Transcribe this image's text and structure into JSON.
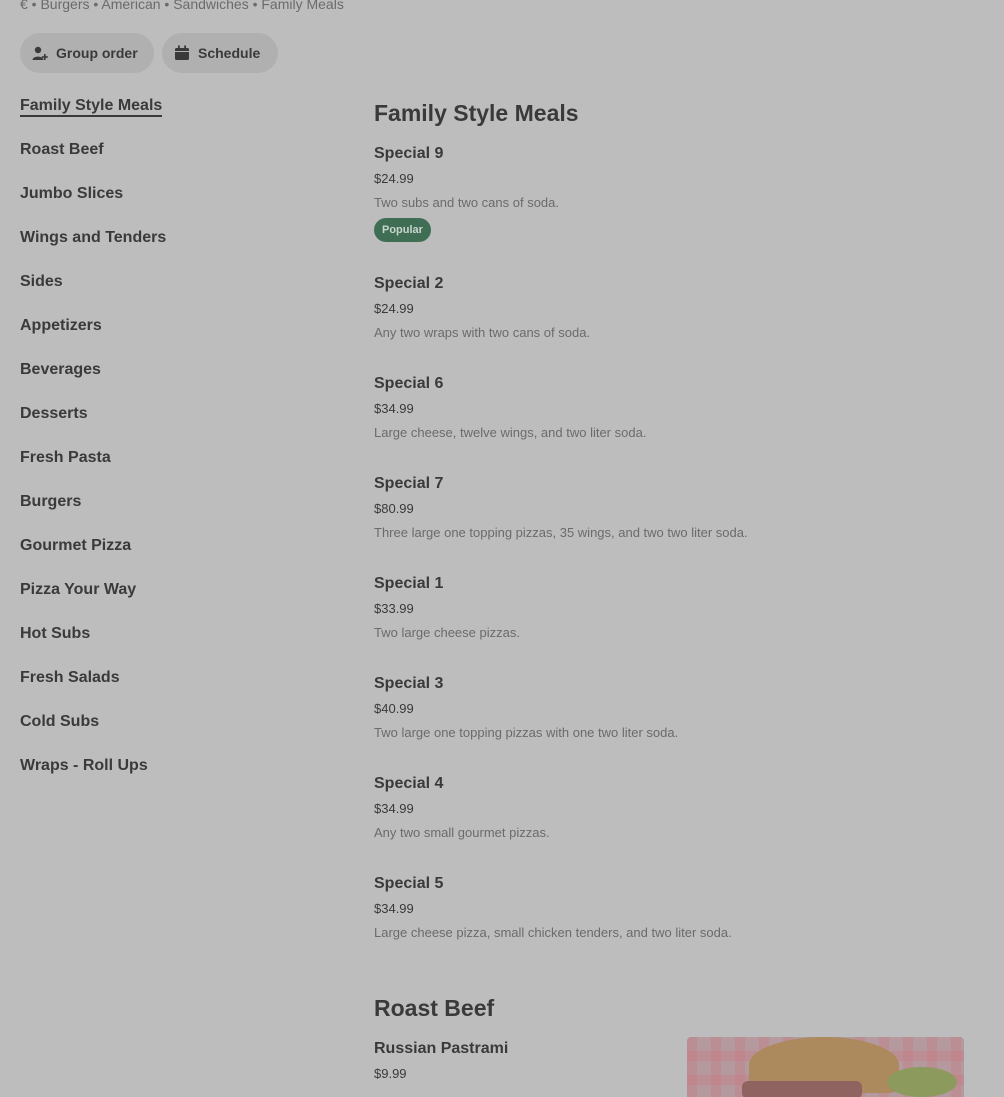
{
  "header": {
    "tagline": "€ • Burgers • American • Sandwiches • Family Meals",
    "group_order_label": "Group order",
    "schedule_label": "Schedule"
  },
  "sidebar": {
    "items": [
      {
        "label": "Family Style Meals",
        "active": true
      },
      {
        "label": "Roast Beef"
      },
      {
        "label": "Jumbo Slices"
      },
      {
        "label": "Wings and Tenders"
      },
      {
        "label": "Sides"
      },
      {
        "label": "Appetizers"
      },
      {
        "label": "Beverages"
      },
      {
        "label": "Desserts"
      },
      {
        "label": "Fresh Pasta"
      },
      {
        "label": "Burgers"
      },
      {
        "label": "Gourmet Pizza"
      },
      {
        "label": "Pizza Your Way"
      },
      {
        "label": "Hot Subs"
      },
      {
        "label": "Fresh Salads"
      },
      {
        "label": "Cold Subs"
      },
      {
        "label": "Wraps - Roll Ups"
      }
    ]
  },
  "sections": [
    {
      "title": "Family Style Meals",
      "items": [
        {
          "name": "Special 9",
          "price": "$24.99",
          "desc": "Two subs and two cans of soda.",
          "badge": "Popular"
        },
        {
          "name": "Special 2",
          "price": "$24.99",
          "desc": "Any two wraps with two cans of soda."
        },
        {
          "name": "Special 6",
          "price": "$34.99",
          "desc": "Large cheese, twelve wings, and two liter soda."
        },
        {
          "name": "Special 7",
          "price": "$80.99",
          "desc": "Three large one topping pizzas, 35 wings, and two two liter soda."
        },
        {
          "name": "Special 1",
          "price": "$33.99",
          "desc": "Two large cheese pizzas."
        },
        {
          "name": "Special 3",
          "price": "$40.99",
          "desc": "Two large one topping pizzas with one two liter soda."
        },
        {
          "name": "Special 4",
          "price": "$34.99",
          "desc": "Any two small gourmet pizzas."
        },
        {
          "name": "Special 5",
          "price": "$34.99",
          "desc": "Large cheese pizza, small chicken tenders, and two liter soda."
        }
      ]
    },
    {
      "title": "Roast Beef",
      "items": [
        {
          "name": "Russian Pastrami",
          "price": "$9.99"
        }
      ]
    }
  ],
  "colors": {
    "background": "#bdbdbd",
    "badge_bg": "#3f6e55",
    "text": "#3a3a3a"
  }
}
